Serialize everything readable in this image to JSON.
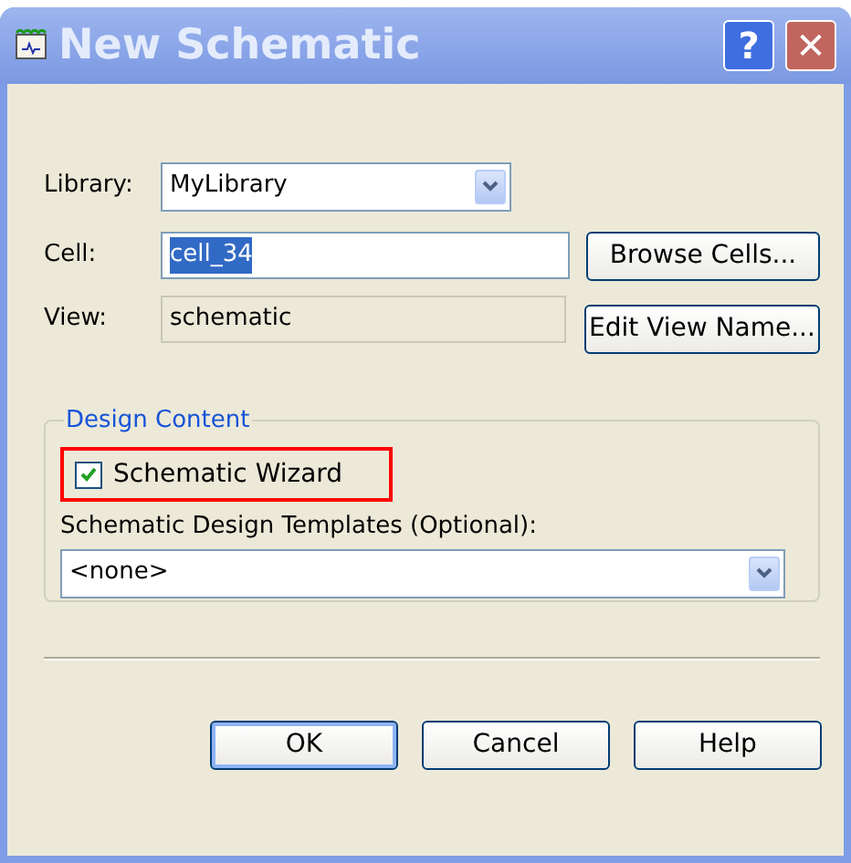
{
  "window": {
    "title": "New Schematic",
    "buttons": [
      {
        "kind": "help",
        "label": "?"
      },
      {
        "kind": "close",
        "label": "✕"
      }
    ]
  },
  "library": {
    "label": "Library:",
    "value": "MyLibrary"
  },
  "cell": {
    "label": "Cell:",
    "value": "cell_34",
    "selected": true,
    "button": "Browse Cells..."
  },
  "view": {
    "label": "View:",
    "value": "schematic",
    "disabled": true,
    "button": "Edit View Name..."
  },
  "design_content": {
    "title": "Design Content",
    "wizard": {
      "label": "Schematic Wizard",
      "checked": true,
      "highlighted": true
    },
    "templates_label": "Schematic Design Templates (Optional):",
    "templates_value": "<none>"
  },
  "buttons": [
    {
      "label": "OK",
      "default": true
    },
    {
      "label": "Cancel",
      "default": false
    },
    {
      "label": "Help",
      "default": false
    }
  ]
}
